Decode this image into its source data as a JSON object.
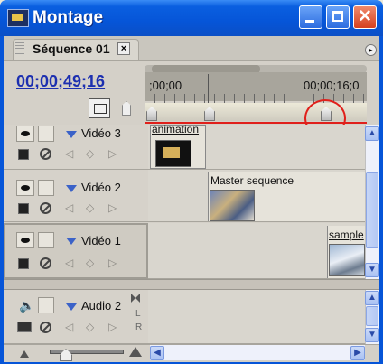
{
  "window": {
    "title": "Montage"
  },
  "tab": {
    "label": "Séquence 01",
    "close_glyph": "×"
  },
  "timeline": {
    "timecode": "00;00;49;16",
    "ruler_start": ";00;00",
    "ruler_mark": "00;00;16;0"
  },
  "tracks": {
    "video3": {
      "name": "Vidéo 3",
      "clip": "animation"
    },
    "video2": {
      "name": "Vidéo 2",
      "clip": "Master sequence"
    },
    "video1": {
      "name": "Vidéo 1",
      "clip": "sample"
    },
    "audio2": {
      "name": "Audio 2",
      "lr": [
        "L",
        "R"
      ]
    }
  },
  "icons": {
    "nav_prev": "◁",
    "nav_key": "◇",
    "nav_next": "▷",
    "speaker": "🔈",
    "menu": "▸"
  },
  "colors": {
    "accent_red": "#e0201b",
    "timecode_blue": "#1c2fb0",
    "titlebar": "#0655d8"
  }
}
